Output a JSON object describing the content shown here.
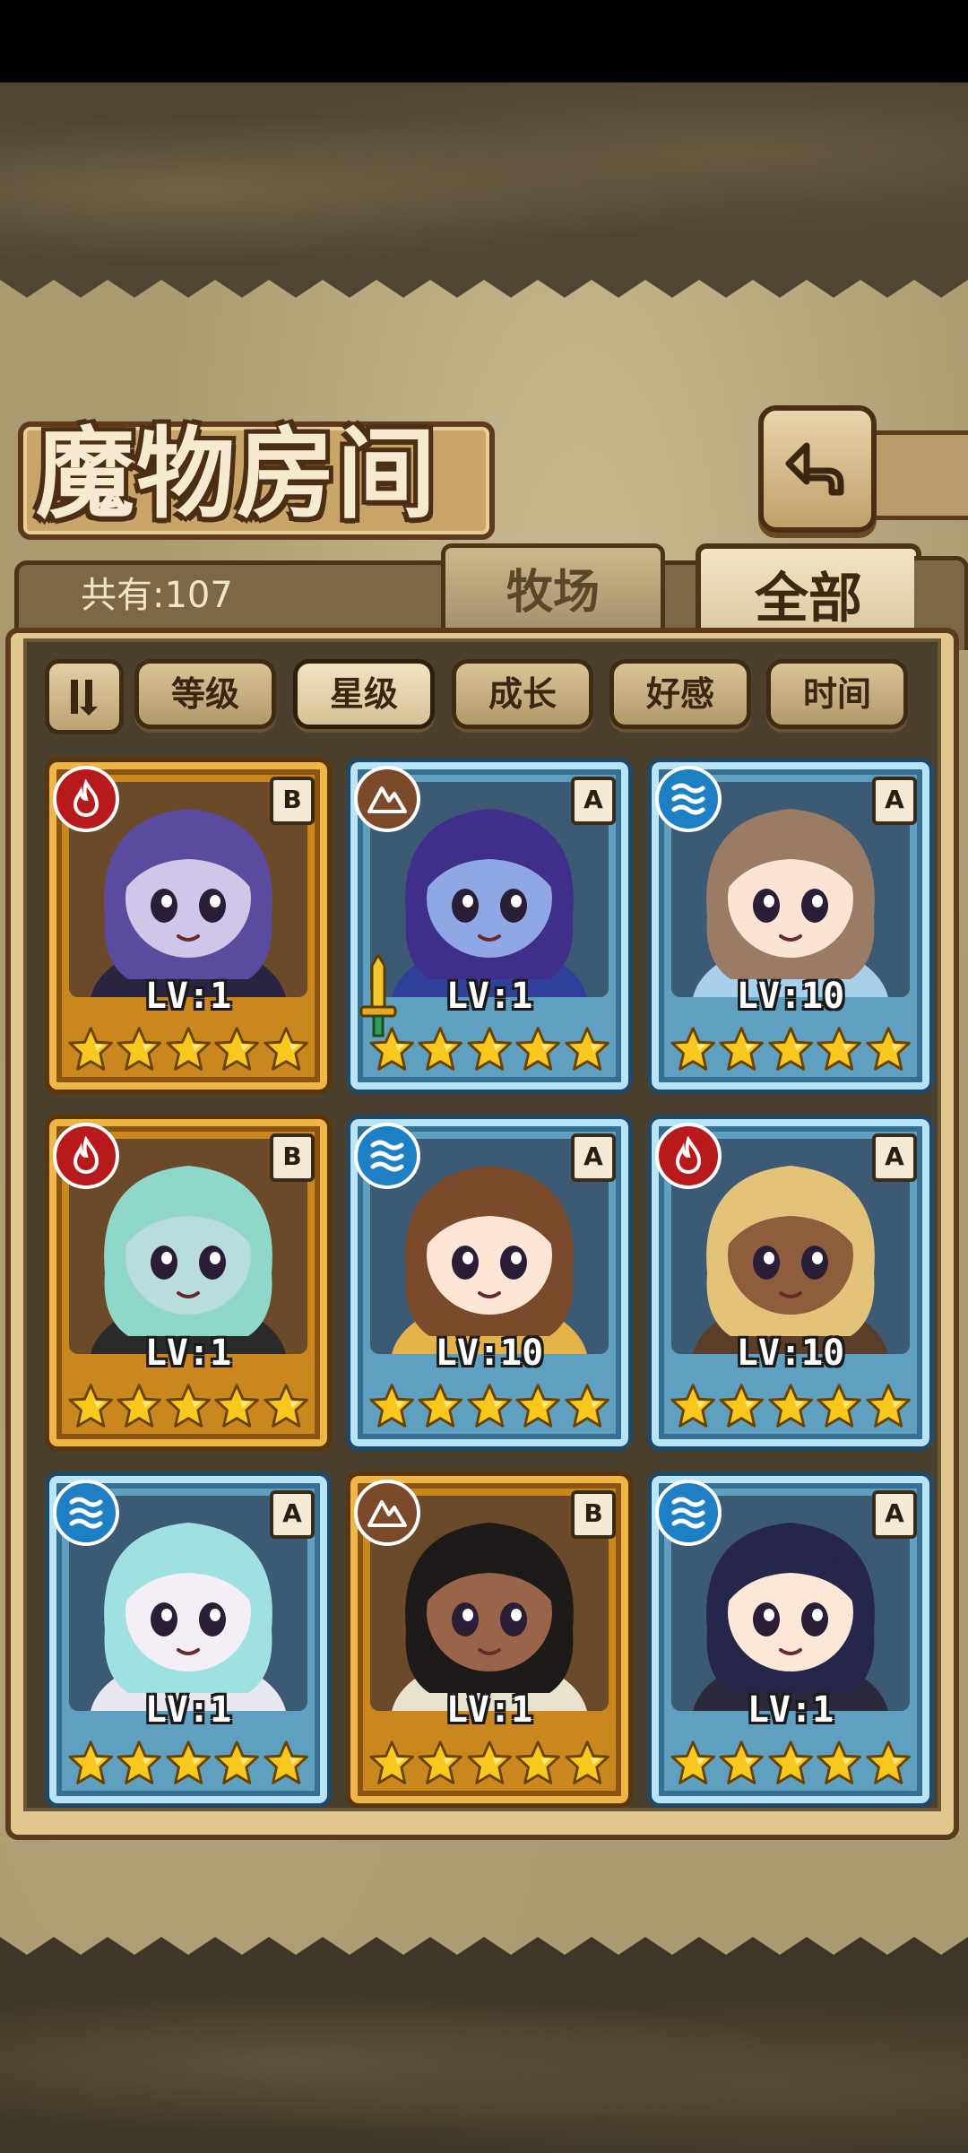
{
  "title": "魔物房间",
  "count_label": "共有:107",
  "tabs": [
    {
      "label": "牧场",
      "selected": false
    },
    {
      "label": "全部",
      "selected": true
    }
  ],
  "sort_buttons": [
    {
      "label": "等级",
      "active": false
    },
    {
      "label": "星级",
      "active": true
    },
    {
      "label": "成长",
      "active": false
    },
    {
      "label": "好感",
      "active": false
    },
    {
      "label": "时间",
      "active": false
    }
  ],
  "cards": [
    {
      "element": "fire-icon",
      "rank": "B",
      "level": "LV:1",
      "stars": 5,
      "frame": "gold",
      "hair": "#5b4b9e",
      "skin": "#cfc6e8",
      "accent": "#2b2440"
    },
    {
      "element": "earth-icon",
      "rank": "A",
      "level": "LV:1",
      "stars": 5,
      "frame": "blue",
      "hair": "#3f2f8a",
      "skin": "#8fa7e4",
      "accent": "#2f3f9a",
      "sword": true
    },
    {
      "element": "water-icon",
      "rank": "A",
      "level": "LV:10",
      "stars": 5,
      "frame": "blue",
      "hair": "#9a7c66",
      "skin": "#fbe4d4",
      "accent": "#a8d0ec"
    },
    {
      "element": "fire-icon",
      "rank": "B",
      "level": "LV:1",
      "stars": 5,
      "frame": "gold",
      "hair": "#8fd8c9",
      "skin": "#b9dcdc",
      "accent": "#2a2a2a"
    },
    {
      "element": "water-icon",
      "rank": "A",
      "level": "LV:10",
      "stars": 5,
      "frame": "blue",
      "hair": "#7a4a2a",
      "skin": "#fde6d6",
      "accent": "#e3b34a"
    },
    {
      "element": "fire-icon",
      "rank": "A",
      "level": "LV:10",
      "stars": 5,
      "frame": "blue",
      "hair": "#e3c27a",
      "skin": "#8f5d3c",
      "accent": "#5a3e2a"
    },
    {
      "element": "water-icon",
      "rank": "A",
      "level": "LV:1",
      "stars": 5,
      "frame": "blue",
      "hair": "#9fe0e0",
      "skin": "#f4eef7",
      "accent": "#e8e8f2"
    },
    {
      "element": "earth-icon",
      "rank": "B",
      "level": "LV:1",
      "stars": 5,
      "frame": "gold",
      "hair": "#1f1a1a",
      "skin": "#9a6448",
      "accent": "#e9e2cf"
    },
    {
      "element": "water-icon",
      "rank": "A",
      "level": "LV:1",
      "stars": 5,
      "frame": "blue",
      "hair": "#26264a",
      "skin": "#fde8d8",
      "accent": "#2a2a3a"
    }
  ]
}
